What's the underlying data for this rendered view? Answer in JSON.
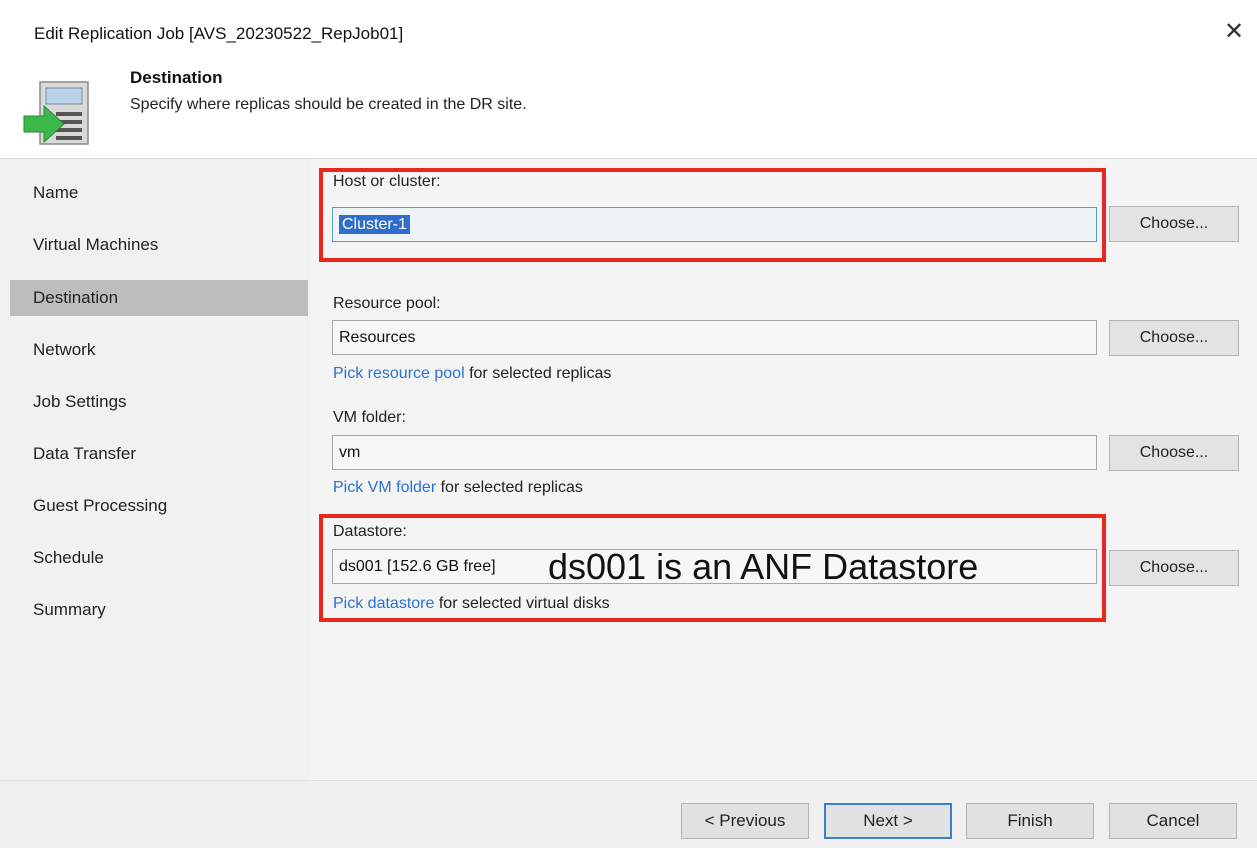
{
  "window": {
    "title": "Edit Replication Job [AVS_20230522_RepJob01]",
    "close_glyph": "✕"
  },
  "header": {
    "title": "Destination",
    "subtitle": "Specify where replicas should be created in the DR site.",
    "icon": "destination-arrow-icon"
  },
  "sidebar": {
    "items": [
      {
        "label": "Name"
      },
      {
        "label": "Virtual Machines"
      },
      {
        "label": "Destination",
        "active": true
      },
      {
        "label": "Network"
      },
      {
        "label": "Job Settings"
      },
      {
        "label": "Data Transfer"
      },
      {
        "label": "Guest Processing"
      },
      {
        "label": "Schedule"
      },
      {
        "label": "Summary"
      }
    ]
  },
  "form": {
    "host": {
      "label": "Host or cluster:",
      "value": "Cluster-1",
      "button": "Choose..."
    },
    "resource_pool": {
      "label": "Resource pool:",
      "value": "Resources",
      "button": "Choose...",
      "link": "Pick resource pool",
      "link_suffix": "for selected replicas"
    },
    "vm_folder": {
      "label": "VM folder:",
      "value": "vm",
      "button": "Choose...",
      "link": "Pick VM folder",
      "link_suffix": "for selected replicas"
    },
    "datastore": {
      "label": "Datastore:",
      "value": "ds001 [152.6 GB free]",
      "button": "Choose...",
      "link": "Pick datastore",
      "link_suffix": "for selected virtual disks"
    }
  },
  "annotation": {
    "text": "ds001 is an ANF Datastore",
    "color": "#e8281d"
  },
  "footer": {
    "previous": "< Previous",
    "next": "Next >",
    "finish": "Finish",
    "cancel": "Cancel"
  }
}
